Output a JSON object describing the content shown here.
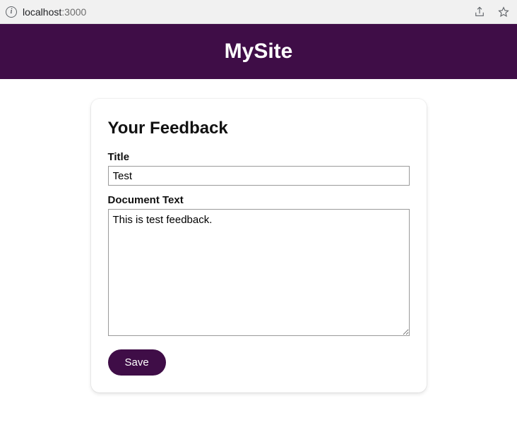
{
  "browser": {
    "url_host": "localhost",
    "url_port": ":3000"
  },
  "header": {
    "site_title": "MySite"
  },
  "form": {
    "heading": "Your Feedback",
    "title_label": "Title",
    "title_value": "Test",
    "body_label": "Document Text",
    "body_value": "This is test feedback.",
    "save_label": "Save"
  }
}
